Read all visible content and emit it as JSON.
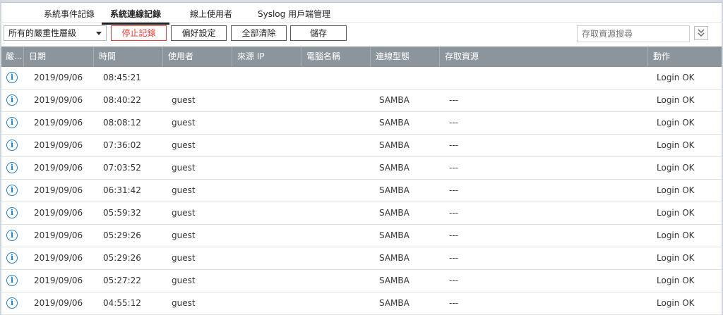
{
  "tabs": [
    {
      "label": "系統事件記錄",
      "active": false
    },
    {
      "label": "系統連線記錄",
      "active": true
    },
    {
      "label": "線上使用者",
      "active": false
    },
    {
      "label": "Syslog 用戶端管理",
      "active": false
    }
  ],
  "toolbar": {
    "severity_select": "所有的嚴重性層級",
    "stop_label": "停止記錄",
    "prefs_label": "偏好設定",
    "clear_label": "全部清除",
    "save_label": "儲存",
    "search_placeholder": "存取資源搜尋"
  },
  "columns": [
    "嚴...",
    "日期",
    "時間",
    "使用者",
    "來源 IP",
    "電腦名稱",
    "連線型態",
    "存取資源",
    "動作"
  ],
  "rows": [
    {
      "icon": "info-icon",
      "date": "2019/09/06",
      "time": "08:45:21",
      "user": "",
      "source_ip": "",
      "computer": "",
      "conn_type": "",
      "resource": "",
      "action": "Login OK"
    },
    {
      "icon": "info-icon",
      "date": "2019/09/06",
      "time": "08:40:22",
      "user": "guest",
      "source_ip": "",
      "computer": "",
      "conn_type": "SAMBA",
      "resource": "---",
      "action": "Login OK"
    },
    {
      "icon": "info-icon",
      "date": "2019/09/06",
      "time": "08:08:12",
      "user": "guest",
      "source_ip": "",
      "computer": "",
      "conn_type": "SAMBA",
      "resource": "---",
      "action": "Login OK"
    },
    {
      "icon": "info-icon",
      "date": "2019/09/06",
      "time": "07:36:02",
      "user": "guest",
      "source_ip": "",
      "computer": "",
      "conn_type": "SAMBA",
      "resource": "---",
      "action": "Login OK"
    },
    {
      "icon": "info-icon",
      "date": "2019/09/06",
      "time": "07:03:52",
      "user": "guest",
      "source_ip": "",
      "computer": "",
      "conn_type": "SAMBA",
      "resource": "---",
      "action": "Login OK"
    },
    {
      "icon": "info-icon",
      "date": "2019/09/06",
      "time": "06:31:42",
      "user": "guest",
      "source_ip": "",
      "computer": "",
      "conn_type": "SAMBA",
      "resource": "---",
      "action": "Login OK"
    },
    {
      "icon": "info-icon",
      "date": "2019/09/06",
      "time": "05:59:32",
      "user": "guest",
      "source_ip": "",
      "computer": "",
      "conn_type": "SAMBA",
      "resource": "---",
      "action": "Login OK"
    },
    {
      "icon": "info-icon",
      "date": "2019/09/06",
      "time": "05:29:26",
      "user": "guest",
      "source_ip": "",
      "computer": "",
      "conn_type": "SAMBA",
      "resource": "---",
      "action": "Login OK"
    },
    {
      "icon": "info-icon",
      "date": "2019/09/06",
      "time": "05:29:26",
      "user": "guest",
      "source_ip": "",
      "computer": "",
      "conn_type": "SAMBA",
      "resource": "---",
      "action": "Login OK"
    },
    {
      "icon": "info-icon",
      "date": "2019/09/06",
      "time": "05:27:22",
      "user": "guest",
      "source_ip": "",
      "computer": "",
      "conn_type": "SAMBA",
      "resource": "---",
      "action": "Login OK"
    },
    {
      "icon": "info-icon",
      "date": "2019/09/06",
      "time": "04:55:12",
      "user": "guest",
      "source_ip": "",
      "computer": "",
      "conn_type": "SAMBA",
      "resource": "---",
      "action": "Login OK"
    }
  ],
  "colors": {
    "header_bg": "#8c959c",
    "info_icon": "#1e7fd6",
    "stop_button": "#e53935"
  }
}
